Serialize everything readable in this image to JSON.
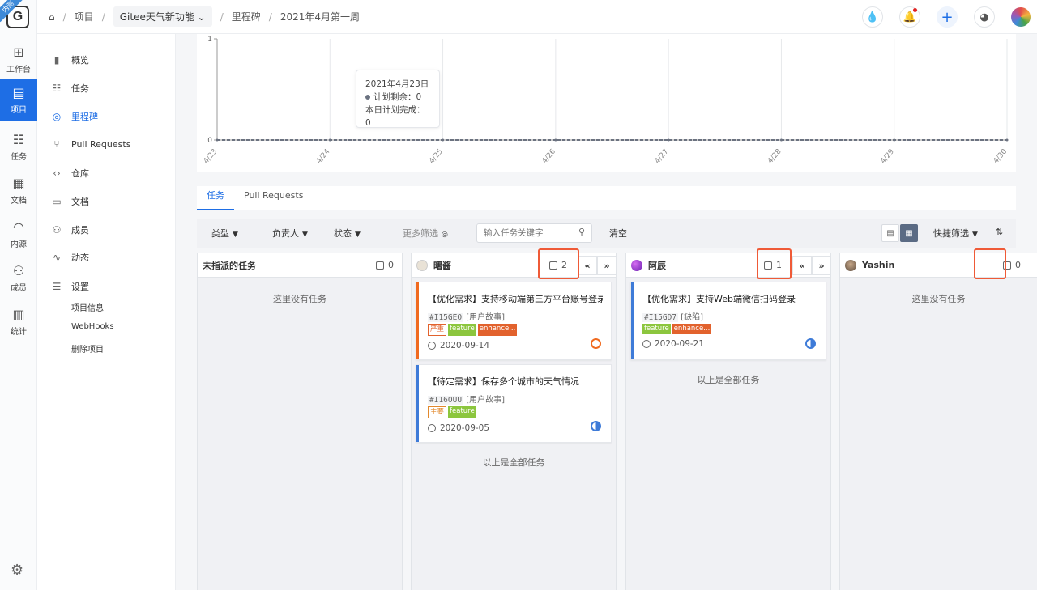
{
  "rail": {
    "badge": "内测",
    "logo": "G",
    "items": [
      {
        "label": "工作台",
        "icon": "grid-icon"
      },
      {
        "label": "项目",
        "icon": "book-icon",
        "active": true
      },
      {
        "label": "任务",
        "icon": "task-icon"
      },
      {
        "label": "文档",
        "icon": "doc-icon"
      },
      {
        "label": "内源",
        "icon": "source-icon"
      },
      {
        "label": "成员",
        "icon": "members-icon"
      },
      {
        "label": "统计",
        "icon": "stats-icon"
      }
    ]
  },
  "breadcrumb": {
    "root": "项目",
    "project": "Gitee天气新功能",
    "section": "里程碑",
    "milestone": "2021年4月第一周"
  },
  "sidebar": {
    "items": [
      {
        "label": "概览",
        "icon": "chart-icon"
      },
      {
        "label": "任务",
        "icon": "task-icon"
      },
      {
        "label": "里程碑",
        "icon": "milestone-icon",
        "active": true
      },
      {
        "label": "Pull Requests",
        "icon": "pull-request-icon"
      },
      {
        "label": "仓库",
        "icon": "code-icon"
      },
      {
        "label": "文档",
        "icon": "doc-icon"
      },
      {
        "label": "成员",
        "icon": "member-icon"
      },
      {
        "label": "动态",
        "icon": "activity-icon"
      },
      {
        "label": "设置",
        "icon": "settings-icon"
      }
    ],
    "settings_sub": [
      "项目信息",
      "WebHooks",
      "删除项目"
    ]
  },
  "chart_data": {
    "type": "line",
    "title": "",
    "xlabel": "",
    "ylabel": "",
    "categories": [
      "4/23",
      "4/24",
      "4/25",
      "4/26",
      "4/27",
      "4/28",
      "4/29",
      "4/30"
    ],
    "series": [
      {
        "name": "计划剩余",
        "values": [
          0,
          0,
          0,
          0,
          0,
          0,
          0,
          0
        ]
      }
    ],
    "ylim": [
      0,
      1
    ],
    "yticks": [
      "0",
      "1"
    ],
    "grid": true,
    "tooltip": {
      "date": "2021年4月23日",
      "line1": "计划剩余：0",
      "line2": "本日计划完成：0"
    }
  },
  "tabs": [
    {
      "label": "任务",
      "active": true
    },
    {
      "label": "Pull Requests",
      "active": false
    }
  ],
  "filters": {
    "type": "类型",
    "assignee": "负责人",
    "status": "状态",
    "more": "更多筛选",
    "search_placeholder": "输入任务关键字",
    "clear": "清空",
    "quick": "快捷筛选"
  },
  "columns": [
    {
      "title": "未指派的任务",
      "count": "0",
      "empty": "这里没有任务",
      "cards": []
    },
    {
      "title": "曙酱",
      "count": "2",
      "footer": "以上是全部任务",
      "cards": [
        {
          "title": "【优化需求】支持移动端第三方平台账号登录",
          "id": "#I15GEO",
          "kind": "[用户故事]",
          "tags": [
            "严重",
            "feature",
            "enhance..."
          ],
          "date": "2020-09-14",
          "stripe": "#f06a1f",
          "state_color": "#f06a1f"
        },
        {
          "title": "【待定需求】保存多个城市的天气情况",
          "id": "#I16OUU",
          "kind": "[用户故事]",
          "tags": [
            "主要",
            "feature"
          ],
          "date": "2020-09-05",
          "stripe": "#3e7bd8",
          "state_color": "#3e7bd8"
        }
      ]
    },
    {
      "title": "阿辰",
      "count": "1",
      "footer": "以上是全部任务",
      "cards": [
        {
          "title": "【优化需求】支持Web端微信扫码登录",
          "id": "#I15GD7",
          "kind": "[缺陷]",
          "tags": [
            "feature",
            "enhance..."
          ],
          "date": "2020-09-21",
          "stripe": "#3e7bd8",
          "state_color": "#3e7bd8"
        }
      ]
    },
    {
      "title": "Yashin",
      "count": "0",
      "empty": "这里没有任务",
      "cards": []
    }
  ]
}
